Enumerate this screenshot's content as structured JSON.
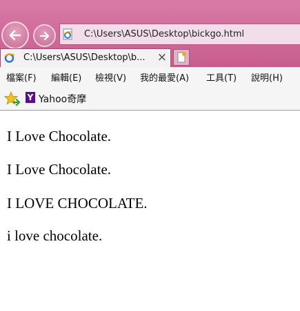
{
  "address": {
    "url": "C:\\Users\\ASUS\\Desktop\\bickgo.html"
  },
  "tab": {
    "title": "C:\\Users\\ASUS\\Desktop\\b...",
    "close": "×"
  },
  "menu": {
    "items": [
      "檔案(F)",
      "編輯(E)",
      "檢視(V)",
      "我的最愛(A)",
      "工具(T)",
      "說明(H)"
    ]
  },
  "favorites": {
    "items": [
      {
        "label": "Yahoo奇摩",
        "icon_letter": "Y"
      }
    ]
  },
  "content": {
    "lines": [
      "I Love Chocolate.",
      "I Love Chocolate.",
      "I LOVE CHOCOLATE.",
      "i love chocolate."
    ]
  },
  "icons": {
    "back": "back-arrow-icon",
    "forward": "forward-arrow-icon",
    "page": "ie-page-icon",
    "new_tab": "new-tab-icon",
    "favorites": "favorites-star-icon"
  },
  "colors": {
    "chrome": "#c75d8c",
    "address_bar": "#f2ddea",
    "yahoo": "#5b0d8f"
  }
}
